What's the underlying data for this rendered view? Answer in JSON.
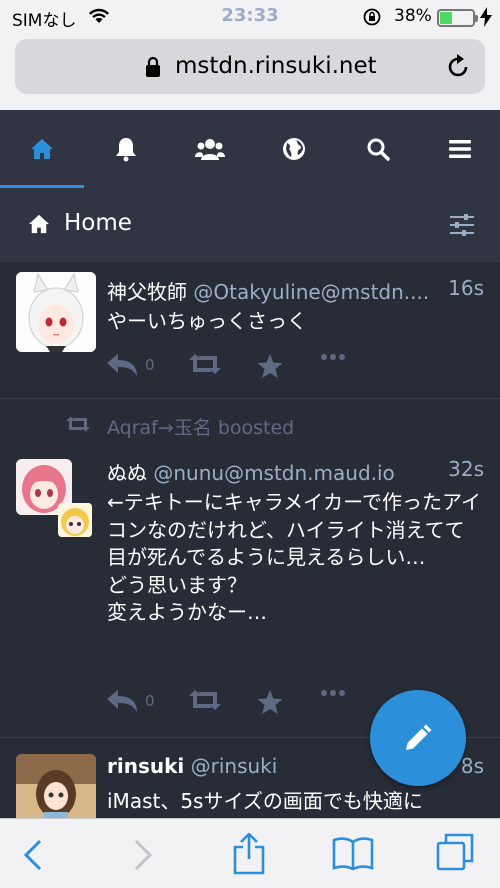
{
  "statusbar": {
    "carrier": "SIMなし",
    "time": "23:33",
    "battery": "38%",
    "battery_level": 0.38
  },
  "browser": {
    "url": "mstdn.rinsuki.net"
  },
  "tabs": [
    {
      "name": "home",
      "active": true
    },
    {
      "name": "notifications"
    },
    {
      "name": "local"
    },
    {
      "name": "federated"
    },
    {
      "name": "search"
    },
    {
      "name": "menu"
    }
  ],
  "column": {
    "title": "Home"
  },
  "statuses": [
    {
      "display_name": "神父牧師",
      "acct": "@Otakyuline@mstdn....",
      "time": "16s",
      "content": "やーいちゅっくさっく",
      "reply_count": "0"
    },
    {
      "boosted_by": "Aqraf→玉名 boosted",
      "display_name": "ぬぬ",
      "acct": "@nunu@mstdn.maud.io",
      "time": "32s",
      "content": "←テキトーにキャラメイカーで作ったアイコンなのだけれど、ハイライト消えてて目が死んでるように見えるらしい…\nどう思います？\n変えようかなー…",
      "reply_count": "0"
    },
    {
      "display_name": "rinsuki",
      "acct": "@rinsuki",
      "time": "8s",
      "content": "iMast、5sサイズの画面でも快適に"
    }
  ],
  "colors": {
    "accent": "#2b90d9",
    "background": "#282c37",
    "header": "#313543",
    "muted": "#606984",
    "secondary_text": "#9baec8"
  }
}
